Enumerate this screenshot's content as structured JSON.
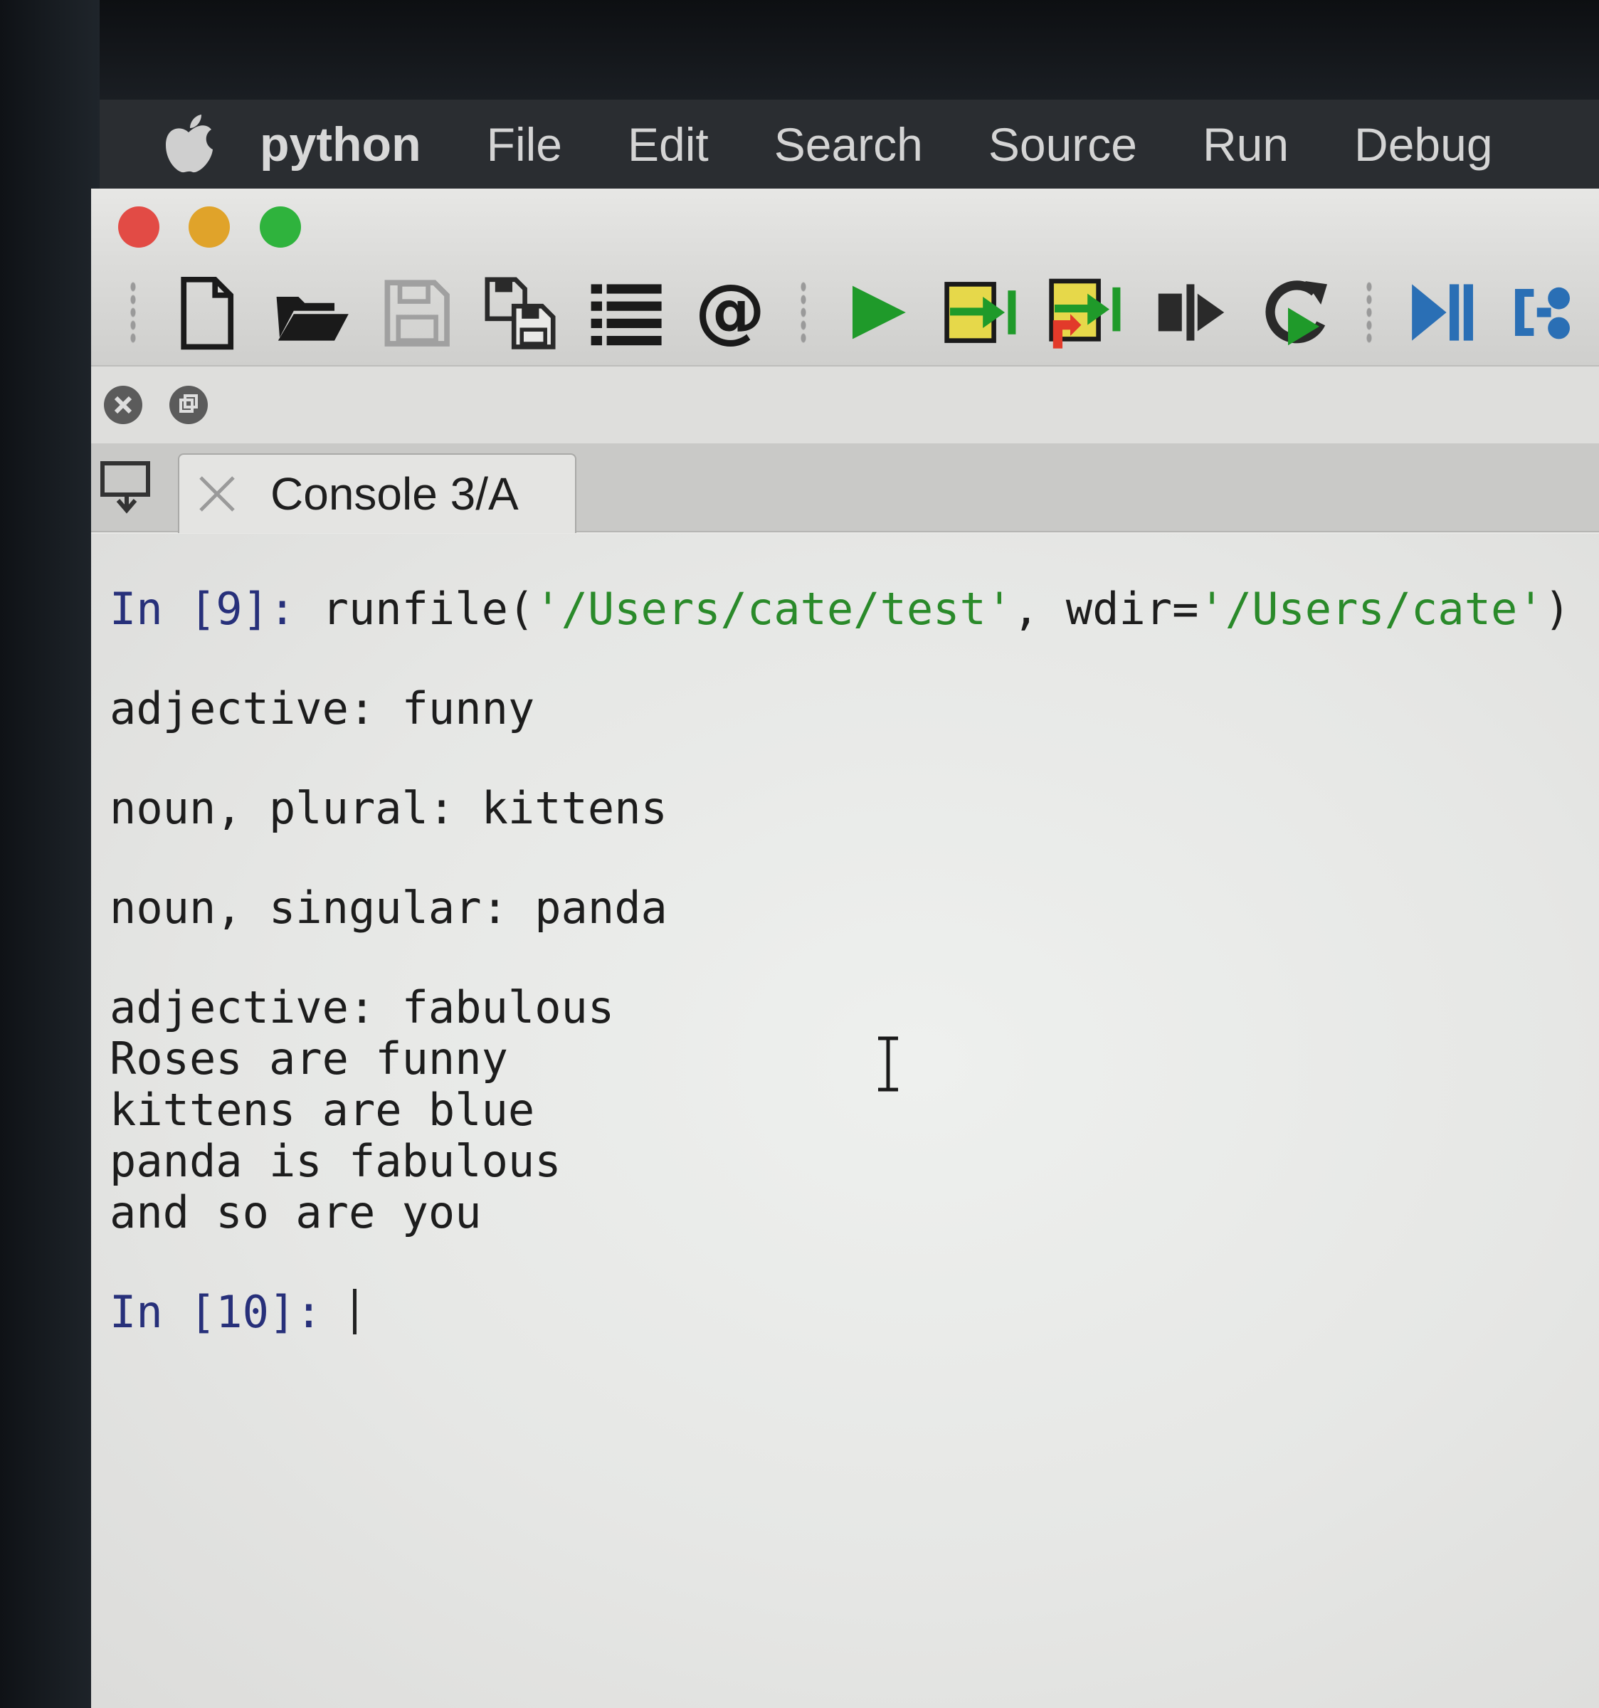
{
  "menubar": {
    "app": "python",
    "items": [
      "File",
      "Edit",
      "Search",
      "Source",
      "Run",
      "Debug"
    ]
  },
  "toolbar": {
    "icons": [
      "new-file-icon",
      "open-folder-icon",
      "save-icon",
      "save-all-icon",
      "list-icon",
      "at-icon",
      "run-icon",
      "run-cell-icon",
      "run-cell-advance-icon",
      "run-selection-icon",
      "rerun-icon",
      "debug-step-icon",
      "debug-continue-icon"
    ]
  },
  "tab": {
    "label": "Console 3/A"
  },
  "console": {
    "in9_prompt": "In [9]: ",
    "in9_func": "runfile(",
    "in9_arg1": "'/Users/cate/test'",
    "in9_sep": ", wdir=",
    "in9_arg2": "'/Users/cate'",
    "in9_close": ")",
    "out1": "adjective: funny",
    "out2": "noun, plural: kittens",
    "out3": "noun, singular: panda",
    "out4": "adjective: fabulous",
    "out5": "Roses are funny",
    "out6": "kittens are blue",
    "out7": "panda is fabulous",
    "out8": "and so are you",
    "in10_prompt": "In [10]: "
  },
  "colors": {
    "prompt": "#27307a",
    "string": "#2a8a2a",
    "run_green": "#1f9a2a",
    "debug_blue": "#2a6fb5"
  }
}
